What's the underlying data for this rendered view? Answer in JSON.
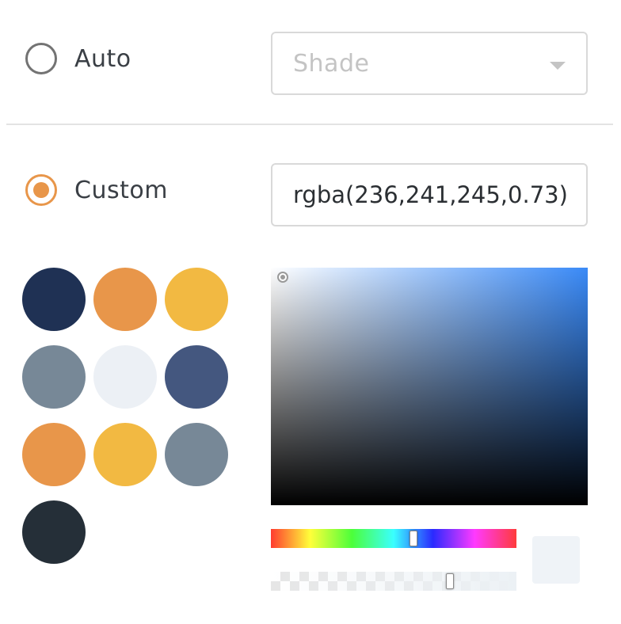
{
  "shading": {
    "auto": {
      "label": "Auto",
      "selected": false
    },
    "custom": {
      "label": "Custom",
      "selected": true
    }
  },
  "shade_select": {
    "placeholder": "Shade"
  },
  "color_input": {
    "value": "rgba(236,241,245,0.73)"
  },
  "swatches": [
    {
      "name": "swatch-navy",
      "color": "#1f3154"
    },
    {
      "name": "swatch-orange",
      "color": "#e8964a"
    },
    {
      "name": "swatch-yellow",
      "color": "#f2b942"
    },
    {
      "name": "swatch-slate",
      "color": "#778897"
    },
    {
      "name": "swatch-light-gray",
      "color": "#ecf0f5"
    },
    {
      "name": "swatch-indigo",
      "color": "#44577f"
    },
    {
      "name": "swatch-orange-2",
      "color": "#e8964a"
    },
    {
      "name": "swatch-yellow-2",
      "color": "#f2b942"
    },
    {
      "name": "swatch-slate-2",
      "color": "#778897"
    },
    {
      "name": "swatch-charcoal",
      "color": "#252f38"
    }
  ],
  "picker": {
    "hue_base_color": "#3a8af7",
    "hue_position": 0.58,
    "alpha_position": 0.73,
    "preview_color": "#eff3f7"
  }
}
